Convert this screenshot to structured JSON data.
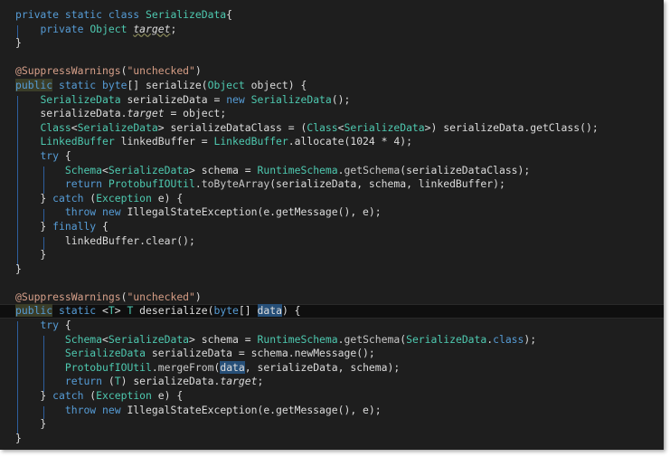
{
  "editor": {
    "lines": [
      [
        [
          "k",
          "private static class "
        ],
        [
          "t",
          "SerializeData"
        ],
        [
          "p",
          "{"
        ]
      ],
      [
        [
          "p",
          "    "
        ],
        [
          "k",
          "private "
        ],
        [
          "t",
          "Object "
        ],
        [
          "w",
          "target"
        ],
        [
          "p",
          ";"
        ]
      ],
      [
        [
          "p",
          "}"
        ]
      ],
      [],
      [
        [
          "a",
          "@SuppressWarnings"
        ],
        [
          "p",
          "("
        ],
        [
          "s",
          "\"unchecked\""
        ],
        [
          "p",
          ")"
        ]
      ],
      [
        [
          "hk",
          "public"
        ],
        [
          "k",
          " static byte"
        ],
        [
          "p",
          "[] serialize("
        ],
        [
          "t",
          "Object"
        ],
        [
          "p",
          " object) {"
        ]
      ],
      [
        [
          "p",
          "    "
        ],
        [
          "t",
          "SerializeData"
        ],
        [
          "p",
          " serializeData = "
        ],
        [
          "k",
          "new "
        ],
        [
          "t",
          "SerializeData"
        ],
        [
          "p",
          "();"
        ]
      ],
      [
        [
          "p",
          "    serializeData."
        ],
        [
          "i",
          "target"
        ],
        [
          "p",
          " = object;"
        ]
      ],
      [
        [
          "p",
          "    "
        ],
        [
          "t",
          "Class"
        ],
        [
          "p",
          "<"
        ],
        [
          "t",
          "SerializeData"
        ],
        [
          "p",
          "> serializeDataClass = ("
        ],
        [
          "t",
          "Class"
        ],
        [
          "p",
          "<"
        ],
        [
          "t",
          "SerializeData"
        ],
        [
          "p",
          ">) serializeData.getClass();"
        ]
      ],
      [
        [
          "p",
          "    "
        ],
        [
          "t",
          "LinkedBuffer"
        ],
        [
          "p",
          " linkedBuffer = "
        ],
        [
          "t",
          "LinkedBuffer"
        ],
        [
          "p",
          ".allocate(1024 * 4);"
        ]
      ],
      [
        [
          "p",
          "    "
        ],
        [
          "k",
          "try"
        ],
        [
          "p",
          " {"
        ]
      ],
      [
        [
          "p",
          "        "
        ],
        [
          "t",
          "Schema"
        ],
        [
          "p",
          "<"
        ],
        [
          "t",
          "SerializeData"
        ],
        [
          "p",
          "> schema = "
        ],
        [
          "t",
          "RuntimeSchema"
        ],
        [
          "p",
          "."
        ],
        [
          "m",
          "getSchema"
        ],
        [
          "p",
          "(serializeDataClass);"
        ]
      ],
      [
        [
          "p",
          "        "
        ],
        [
          "k",
          "return "
        ],
        [
          "t",
          "ProtobufIOUtil"
        ],
        [
          "p",
          "."
        ],
        [
          "m",
          "toByteArray"
        ],
        [
          "p",
          "(serializeData, schema, linkedBuffer);"
        ]
      ],
      [
        [
          "p",
          "    } "
        ],
        [
          "k",
          "catch"
        ],
        [
          "p",
          " ("
        ],
        [
          "t",
          "Exception"
        ],
        [
          "p",
          " e) {"
        ]
      ],
      [
        [
          "p",
          "        "
        ],
        [
          "k",
          "throw new "
        ],
        [
          "p",
          "IllegalStateException(e.getMessage(), e);"
        ]
      ],
      [
        [
          "p",
          "    } "
        ],
        [
          "k",
          "finally"
        ],
        [
          "p",
          " {"
        ]
      ],
      [
        [
          "p",
          "        linkedBuffer.clear();"
        ]
      ],
      [
        [
          "p",
          "    }"
        ]
      ],
      [
        [
          "p",
          "}"
        ]
      ],
      [],
      [
        [
          "a",
          "@SuppressWarnings"
        ],
        [
          "p",
          "("
        ],
        [
          "s",
          "\"unchecked\""
        ],
        [
          "p",
          ")"
        ]
      ],
      [
        [
          "hk",
          "public"
        ],
        [
          "k",
          " static "
        ],
        [
          "p",
          "<"
        ],
        [
          "t",
          "T"
        ],
        [
          "p",
          "> "
        ],
        [
          "t",
          "T"
        ],
        [
          "p",
          " deserialize("
        ],
        [
          "k",
          "byte"
        ],
        [
          "p",
          "[] "
        ],
        [
          "h",
          "data"
        ],
        [
          "p",
          ") {"
        ]
      ],
      [
        [
          "p",
          "    "
        ],
        [
          "k",
          "try"
        ],
        [
          "p",
          " {"
        ]
      ],
      [
        [
          "p",
          "        "
        ],
        [
          "t",
          "Schema"
        ],
        [
          "p",
          "<"
        ],
        [
          "t",
          "SerializeData"
        ],
        [
          "p",
          "> schema = "
        ],
        [
          "t",
          "RuntimeSchema"
        ],
        [
          "p",
          "."
        ],
        [
          "m",
          "getSchema"
        ],
        [
          "p",
          "("
        ],
        [
          "t",
          "SerializeData"
        ],
        [
          "p",
          "."
        ],
        [
          "k",
          "class"
        ],
        [
          "p",
          ");"
        ]
      ],
      [
        [
          "p",
          "        "
        ],
        [
          "t",
          "SerializeData"
        ],
        [
          "p",
          " serializeData = schema.newMessage();"
        ]
      ],
      [
        [
          "p",
          "        "
        ],
        [
          "t",
          "ProtobufIOUtil"
        ],
        [
          "p",
          "."
        ],
        [
          "m",
          "mergeFrom"
        ],
        [
          "p",
          "("
        ],
        [
          "h",
          "data"
        ],
        [
          "p",
          ", serializeData, schema);"
        ]
      ],
      [
        [
          "p",
          "        "
        ],
        [
          "k",
          "return"
        ],
        [
          "p",
          " ("
        ],
        [
          "t",
          "T"
        ],
        [
          "p",
          ") serializeData."
        ],
        [
          "i",
          "target"
        ],
        [
          "p",
          ";"
        ]
      ],
      [
        [
          "p",
          "    } "
        ],
        [
          "k",
          "catch"
        ],
        [
          "p",
          " ("
        ],
        [
          "t",
          "Exception"
        ],
        [
          "p",
          " e) {"
        ]
      ],
      [
        [
          "p",
          "        "
        ],
        [
          "k",
          "throw new "
        ],
        [
          "p",
          "IllegalStateException(e.getMessage(), e);"
        ]
      ],
      [
        [
          "p",
          "    }"
        ]
      ],
      [
        [
          "p",
          "}"
        ]
      ]
    ],
    "current_line": 21
  }
}
